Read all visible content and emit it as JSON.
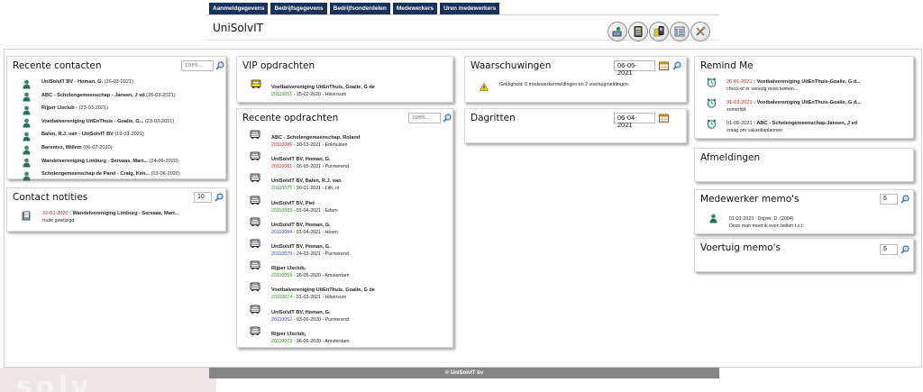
{
  "app_title": "UniSolvIT",
  "watermark_text": "solv",
  "footer": "© UniSolvIT bv",
  "tabs": [
    "Aanmeldgegevens",
    "Bedrijfsgegevens",
    "Bedrijfsonderdelen",
    "Medewerkers",
    "Uren medewerkers"
  ],
  "colors": {
    "tab_bg": "#19325c",
    "green_id": "#2a8b12",
    "red_id": "#d01818",
    "blue_id": "#2d3fc0",
    "footer_bg": "#858585"
  },
  "recente_contacten": {
    "title": "Recente contacten",
    "search_placeholder": "zoek...",
    "items": [
      {
        "name": "UniSolvIT BV - Homan, G.",
        "date": " (26-03-2021)"
      },
      {
        "name": "ABC - Scholengemeenschap - Jansen, J vd",
        "date": " (26-03-2021)"
      },
      {
        "name": "Rijper IJsclub -",
        "date": " (23-03-2021)"
      },
      {
        "name": "Voetbalvereniging UitEnThuis - Goalie, G...",
        "date": " (23-03-2021)"
      },
      {
        "name": "Balen, R.J. van - UniSolvIT BV",
        "date": " (19-03-2021)"
      },
      {
        "name": "Barentsz, Willem",
        "date": " (06-07-2020)"
      },
      {
        "name": "Wandelvereniging Limburg - Servaas, Mart...",
        "date": " (24-06-2020)"
      },
      {
        "name": "Scholengemeenschap de Parel - Craig, Ken...",
        "date": " (03-06-2020)"
      }
    ]
  },
  "contact_notities": {
    "title": "Contact notities",
    "count": "10",
    "items": [
      {
        "date": "22-02-2020",
        "name": " : Wandelvereniging Limburg - Servaas, Mart...",
        "text": "route gewijzigd"
      }
    ]
  },
  "vip_opdrachten": {
    "title": "VIP opdrachten",
    "items": [
      {
        "name": "Voetbalvereniging UitEnThuis, Goalie, G de",
        "id": "20110051",
        "rest": " - 25-02-2020 - Hilversum"
      }
    ]
  },
  "recente_opdrachten": {
    "title": "Recente opdrachten",
    "search_placeholder": "zoek...",
    "items": [
      {
        "name": "ABC - Scholengemeenschap, Roland",
        "id": "20110086",
        "rest": " - 30-03-2021 - Enkhuizen",
        "color": "red"
      },
      {
        "name": "UniSolvIT BV, Homan, G.",
        "id": "20110081",
        "rest": " - 05-05-2021 - Purmerend",
        "color": "red"
      },
      {
        "name": "UniSolvIT BV, Balen, R.J. van",
        "id": "20110075",
        "rest": " - 20-01-2021 - Lith, nl",
        "color": "green"
      },
      {
        "name": "UniSolvIT BV, Piet",
        "id": "20110083",
        "rest": " - 01-04-2021 - Edam",
        "color": "green"
      },
      {
        "name": "UniSolvIT BV, Homan, G.",
        "id": "20110084",
        "rest": " - 01-04-2021 - Hoorn",
        "color": "blue"
      },
      {
        "name": "UniSolvIT BV, Homan, G.",
        "id": "20110079",
        "rest": " - 24-03-2021 - Purmerend",
        "color": "blue"
      },
      {
        "name": "Rijper IJsclub,",
        "id": "20110059",
        "rest": " - 26-06-2020 - Amsterdam",
        "color": "green"
      },
      {
        "name": "Voetbalvereniging UitEnThuis, Goalie, G de",
        "id": "20110074",
        "rest": " - 01-03-2021 - Hilversum",
        "color": "green"
      },
      {
        "name": "UniSolvIT BV, Homan, G.",
        "id": "20110052",
        "rest": " - 03-06-2020 - Purmerend",
        "color": "blue"
      },
      {
        "name": "Rijper IJsclub,",
        "id": "20110073",
        "rest": " - 26-06-2020 - Amsterdam",
        "color": "green"
      }
    ]
  },
  "waarschuwingen": {
    "title": "Waarschuwingen",
    "date": "06-05-2021",
    "text": "Geldigheid: 0 medewerkermeldingen en 2 voertuigmeldingen"
  },
  "dagritten": {
    "title": "Dagritten",
    "date": "06-04-2021"
  },
  "remind_me": {
    "title": "Remind Me",
    "items": [
      {
        "date": "26-01-2021",
        "name": " : Voetbalvereniging UitEnThuis-Goalie, G d...",
        "text": "check of er vervolg moet komen...",
        "date_color": "red"
      },
      {
        "date": "31-03-2021",
        "name": " : Voetbalvereniging UitEnThuis-Goalie, G d...",
        "text": "zomertijd",
        "date_color": "red"
      },
      {
        "date": "01-06-2021",
        "name": " : ABC - Scholengemeenschap-Jansen, J vd",
        "text": "vraag om vakantieplannen",
        "date_color": "normal"
      }
    ]
  },
  "afmeldingen": {
    "title": "Afmeldingen"
  },
  "medewerker_memos": {
    "title": "Medewerker memo's",
    "count": "5",
    "items": [
      {
        "line1": "01-01-2023 : Drijver, D. (2004)",
        "line2": "Deze man moet ik even bellen t.z.t."
      }
    ]
  },
  "voertuig_memos": {
    "title": "Voertuig memo's",
    "count": "5"
  }
}
